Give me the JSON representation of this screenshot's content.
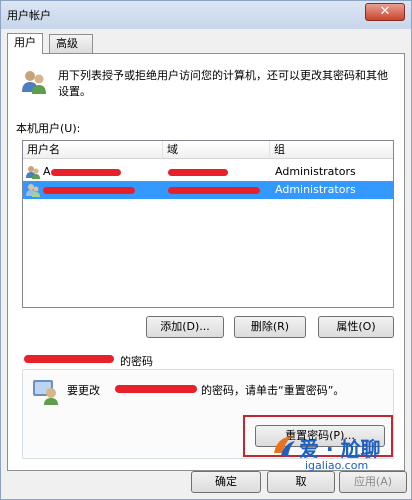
{
  "window": {
    "title": "用户帐户",
    "close_glyph": "✕"
  },
  "tabs": [
    {
      "label": "用户",
      "active": true
    },
    {
      "label": "高级",
      "active": false
    }
  ],
  "intro": {
    "text": "用下列表授予或拒绝用户访问您的计算机，还可以更改其密码和其他设置。"
  },
  "user_list": {
    "label": "本机用户(U):",
    "columns": [
      "用户名",
      "域",
      "组"
    ],
    "rows": [
      {
        "name": "A",
        "group": "Administrators",
        "selected": false
      },
      {
        "name": "",
        "group": "Administrators",
        "selected": true
      }
    ]
  },
  "list_buttons": {
    "add": "添加(D)...",
    "delete": "删除(R)",
    "properties": "属性(O)"
  },
  "password": {
    "heading": "的密码",
    "text_before": "要更改",
    "text_after": "的密码，请单击“重置密码”。",
    "reset_button": "重置密码(P)..."
  },
  "footer": {
    "ok": "确定",
    "cancel": "取",
    "apply": "应用(A)"
  },
  "watermark": {
    "brand": "爱 · 尬聊",
    "url": "igaliao.com"
  },
  "colors": {
    "selection": "#3399ff",
    "scribble": "#e8202a",
    "highlight": "#c0282f",
    "brand": "#1b5fc1"
  },
  "icons": {
    "intro": "users-icon",
    "row": "user-icon",
    "password": "user-key-icon",
    "watermark": "brand-logo-icon"
  }
}
